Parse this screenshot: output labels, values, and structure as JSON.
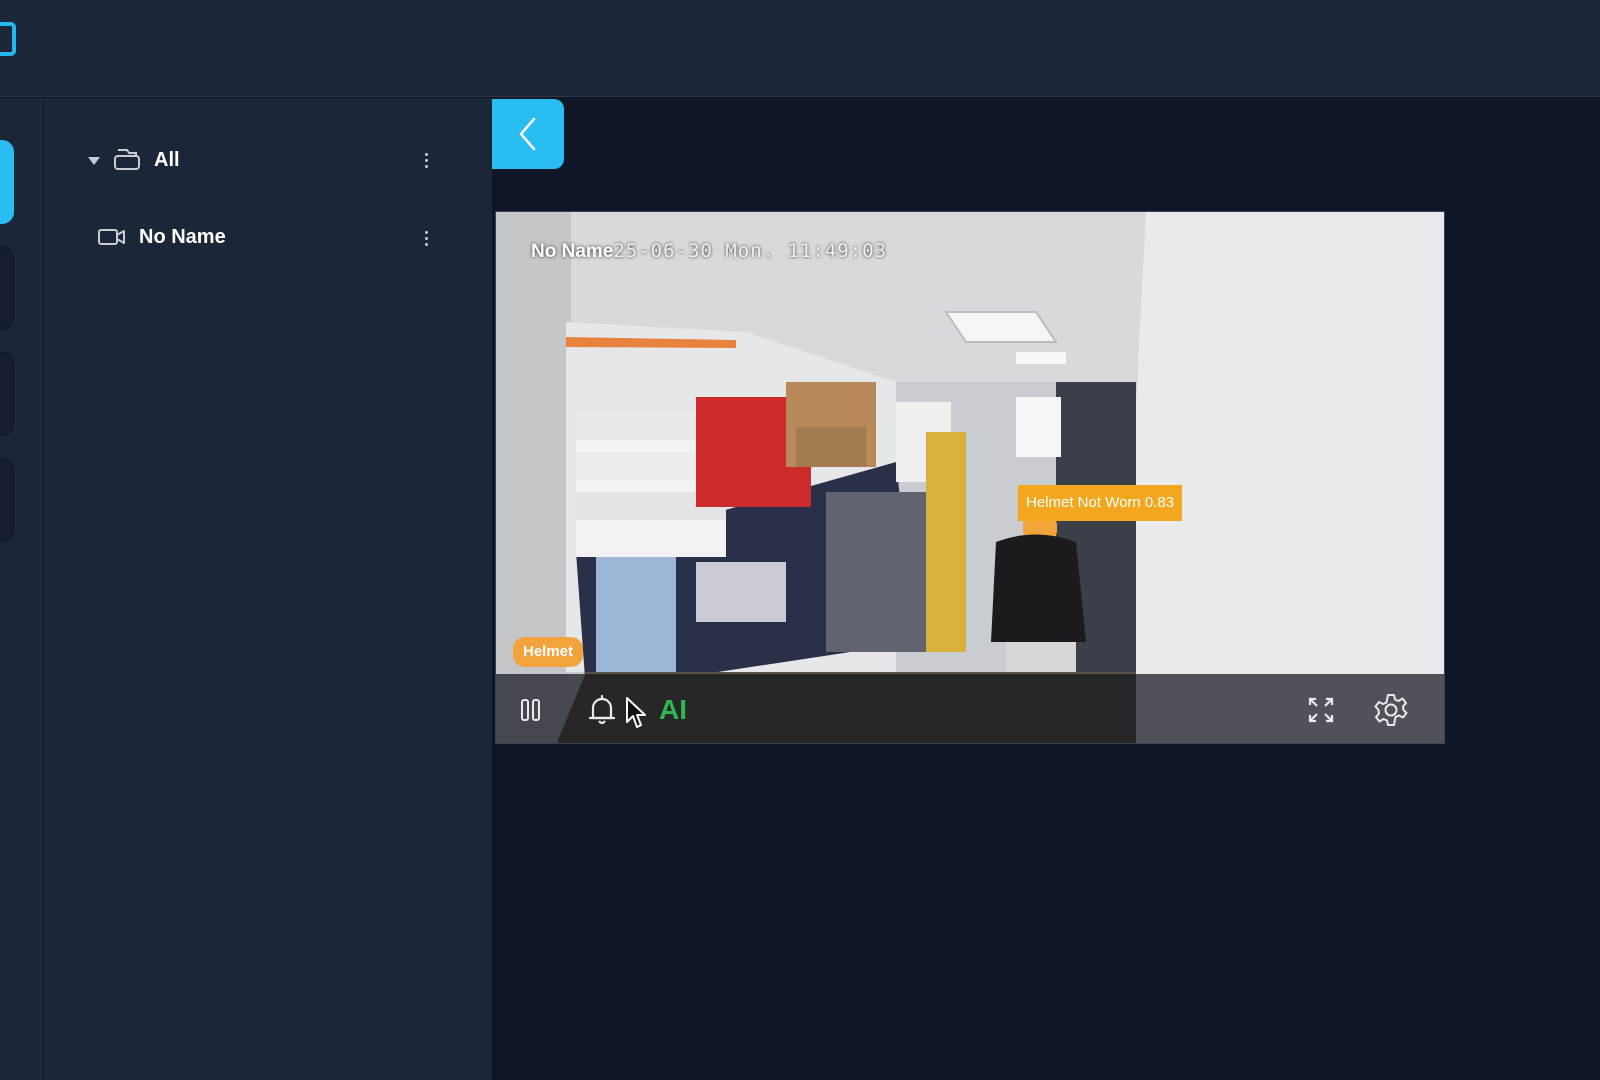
{
  "header": {
    "logo_icon": "app-logo-icon"
  },
  "rail": {
    "active_color": "#29bdf2",
    "tabs": [
      "rail-tab-1",
      "rail-tab-2",
      "rail-tab-3",
      "rail-tab-4"
    ]
  },
  "tree": {
    "root": {
      "label": "All",
      "expand_icon": "caret-down-icon",
      "group_icon": "folder-icon",
      "menu_icon": "more-vertical-icon"
    },
    "items": [
      {
        "label": "No Name",
        "icon": "camera-icon",
        "menu_icon": "more-vertical-icon"
      }
    ]
  },
  "main": {
    "collapse_icon": "chevron-left-icon",
    "video": {
      "camera_name": "No Name",
      "timestamp": "25-06-30 Mon. 11:49:03",
      "detection_label": "Helmet Not Worn 0.83",
      "detection_color": "#f3a71f",
      "mode_badge": "Helmet",
      "controls": {
        "pause_icon": "pause-icon",
        "alarm_icon": "bell-icon",
        "ai_label": "AI",
        "ai_color": "#2fb84f",
        "fullscreen_icon": "fullscreen-icon",
        "settings_icon": "gear-icon"
      }
    }
  }
}
